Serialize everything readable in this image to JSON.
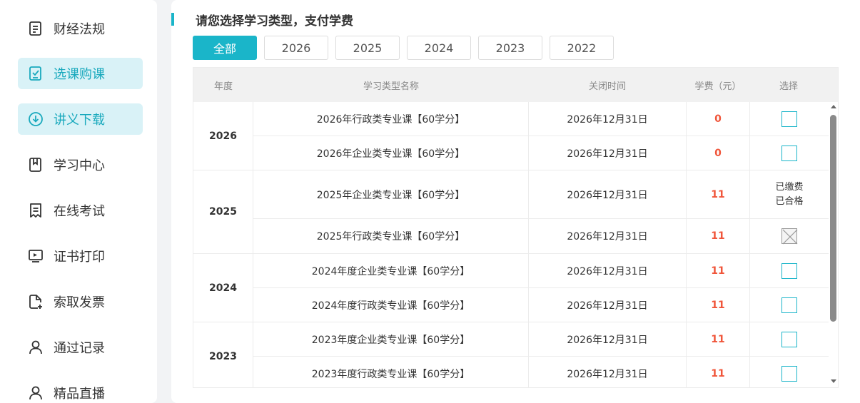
{
  "sidebar": {
    "items": [
      {
        "label": "财经法规",
        "icon": "document-icon",
        "active": false
      },
      {
        "label": "选课购课",
        "icon": "checkbox-icon",
        "active": true
      },
      {
        "label": "讲义下载",
        "icon": "download-icon",
        "active": true
      },
      {
        "label": "学习中心",
        "icon": "bookmark-icon",
        "active": false
      },
      {
        "label": "在线考试",
        "icon": "exam-icon",
        "active": false
      },
      {
        "label": "证书打印",
        "icon": "monitor-icon",
        "active": false
      },
      {
        "label": "索取发票",
        "icon": "invoice-icon",
        "active": false
      },
      {
        "label": "通过记录",
        "icon": "user-icon",
        "active": false
      },
      {
        "label": "精品直播",
        "icon": "user-icon",
        "active": false
      }
    ]
  },
  "main": {
    "title": "请您选择学习类型，支付学费",
    "tabs": [
      "全部",
      "2026",
      "2025",
      "2024",
      "2023",
      "2022"
    ],
    "active_tab": "全部",
    "table": {
      "headers": {
        "year": "年度",
        "name": "学习类型名称",
        "close_time": "关闭时间",
        "fee": "学费（元）",
        "select": "选择"
      },
      "groups": [
        {
          "year": "2026",
          "rows": [
            {
              "name": "2026年行政类专业课【60学分】",
              "close_time": "2026年12月31日",
              "fee": "0",
              "select": "checkbox"
            },
            {
              "name": "2026年企业类专业课【60学分】",
              "close_time": "2026年12月31日",
              "fee": "0",
              "select": "checkbox"
            }
          ]
        },
        {
          "year": "2025",
          "rows": [
            {
              "name": "2025年企业类专业课【60学分】",
              "close_time": "2026年12月31日",
              "fee": "11",
              "select": "status",
              "status1": "已缴费",
              "status2": "已合格"
            },
            {
              "name": "2025年行政类专业课【60学分】",
              "close_time": "2026年12月31日",
              "fee": "11",
              "select": "disabled"
            }
          ]
        },
        {
          "year": "2024",
          "rows": [
            {
              "name": "2024年度企业类专业课【60学分】",
              "close_time": "2026年12月31日",
              "fee": "11",
              "select": "checkbox"
            },
            {
              "name": "2024年度行政类专业课【60学分】",
              "close_time": "2026年12月31日",
              "fee": "11",
              "select": "checkbox"
            }
          ]
        },
        {
          "year": "2023",
          "rows": [
            {
              "name": "2023年度企业类专业课【60学分】",
              "close_time": "2026年12月31日",
              "fee": "11",
              "select": "checkbox"
            },
            {
              "name": "2023年度行政类专业课【60学分】",
              "close_time": "2026年12月31日",
              "fee": "11",
              "select": "checkbox"
            }
          ]
        }
      ]
    }
  },
  "colors": {
    "accent": "#1ab5c9",
    "fee": "#f0553a",
    "active_bg": "#d9f2f7"
  }
}
